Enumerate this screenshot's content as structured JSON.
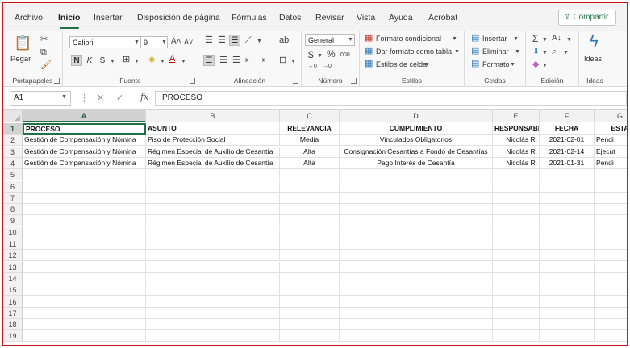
{
  "menu": {
    "items": [
      "Archivo",
      "Inicio",
      "Insertar",
      "Disposición de página",
      "Fórmulas",
      "Datos",
      "Revisar",
      "Vista",
      "Ayuda",
      "Acrobat"
    ],
    "active_index": 1,
    "share_label": "Compartir"
  },
  "ribbon": {
    "clipboard": {
      "paste_label": "Pegar",
      "group_label": "Portapapeles"
    },
    "font": {
      "font_name": "Calibri",
      "font_size": "9",
      "bold": "N",
      "italic": "K",
      "underline": "S",
      "group_label": "Fuente"
    },
    "alignment": {
      "group_label": "Alineación"
    },
    "number": {
      "format": "General",
      "group_label": "Número"
    },
    "styles": {
      "conditional_label": "Formato condicional",
      "table_label": "Dar formato como tabla",
      "cell_styles_label": "Estilos de celda",
      "group_label": "Estilos"
    },
    "cells": {
      "insert_label": "Insertar",
      "delete_label": "Eliminar",
      "format_label": "Formato",
      "group_label": "Celdas"
    },
    "editing": {
      "group_label": "Edición"
    },
    "ideas": {
      "button_label": "Ideas",
      "group_label": "Ideas"
    },
    "accent": "#1e7145"
  },
  "formula_bar": {
    "name_box": "A1",
    "content": "PROCESO"
  },
  "sheet": {
    "columns": [
      "A",
      "B",
      "C",
      "D",
      "E",
      "F",
      "G"
    ],
    "header_row": [
      "PROCESO",
      "ASUNTO",
      "RELEVANCIA",
      "CUMPLIMIENTO",
      "RESPONSABLE",
      "FECHA",
      "ESTA"
    ],
    "rows": [
      [
        "Gestión de Compensación y Nómina",
        "Piso de Protección Social",
        "Media",
        "Vinculados Obligatorios",
        "Nicolás R.",
        "2021-02-01",
        "Pendi"
      ],
      [
        "Gestión de Compensación y Nómina",
        "Régimen Especial de Auxilio de Cesantía",
        "Alta",
        "Consignación Cesantías a Fondo de Cesantías",
        "Nicolás R.",
        "2021-02-14",
        "Ejecut"
      ],
      [
        "Gestión de Compensación y Nómina",
        "Régimen Especial de Auxilio de Cesantía",
        "Alta",
        "Pago Interés de Cesantía",
        "Nicolás R.",
        "2021-01-31",
        "Pendi"
      ]
    ],
    "row_numbers": [
      "1",
      "2",
      "3",
      "4",
      "5",
      "6",
      "7",
      "8",
      "9",
      "10",
      "11",
      "12",
      "13",
      "14",
      "15",
      "16",
      "17",
      "18",
      "19"
    ]
  }
}
